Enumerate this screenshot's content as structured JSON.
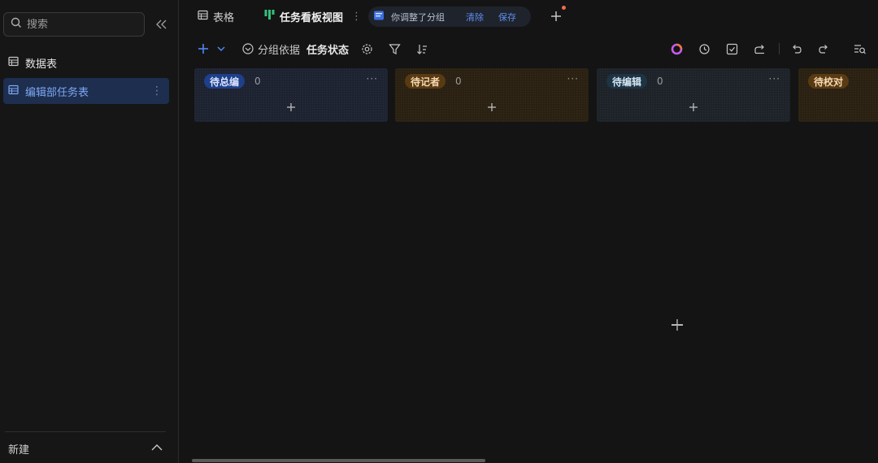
{
  "sidebar": {
    "search_placeholder": "搜索",
    "section_title": "数据表",
    "tables": [
      {
        "label": "编辑部任务表",
        "active": true
      }
    ],
    "more_icon": "⋮",
    "new_label": "新建"
  },
  "tabs": [
    {
      "label": "表格",
      "icon": "grid-table-icon"
    },
    {
      "label": "任务看板视图",
      "icon": "kanban-icon",
      "active": true
    }
  ],
  "tab_more": "⋮",
  "change_notice": {
    "message": "你调整了分组",
    "clear_label": "清除",
    "save_label": "保存"
  },
  "toolbar": {
    "group_by_label": "分组依据",
    "group_by_value": "任务状态"
  },
  "columns": [
    {
      "label": "待总编",
      "count": "0",
      "tag_bg": "#1e3f8a",
      "tag_fg": "#dbe5ff",
      "col_bg": "#1e2332"
    },
    {
      "label": "待记者",
      "count": "0",
      "tag_bg": "#5a3a12",
      "tag_fg": "#f4d9b0",
      "col_bg": "#2a2112"
    },
    {
      "label": "待编辑",
      "count": "0",
      "tag_bg": "#1d3445",
      "tag_fg": "#d4e6f2",
      "col_bg": "#1e232a"
    },
    {
      "label": "待校对",
      "count": "",
      "tag_bg": "#5a3a12",
      "tag_fg": "#f4d9b0",
      "col_bg": "#2a2112"
    }
  ],
  "column_more": "···",
  "colors": {
    "accent": "#4f86f5",
    "sidebar_active_bg": "#1d2e4e",
    "notification_dot": "#f06a52"
  }
}
